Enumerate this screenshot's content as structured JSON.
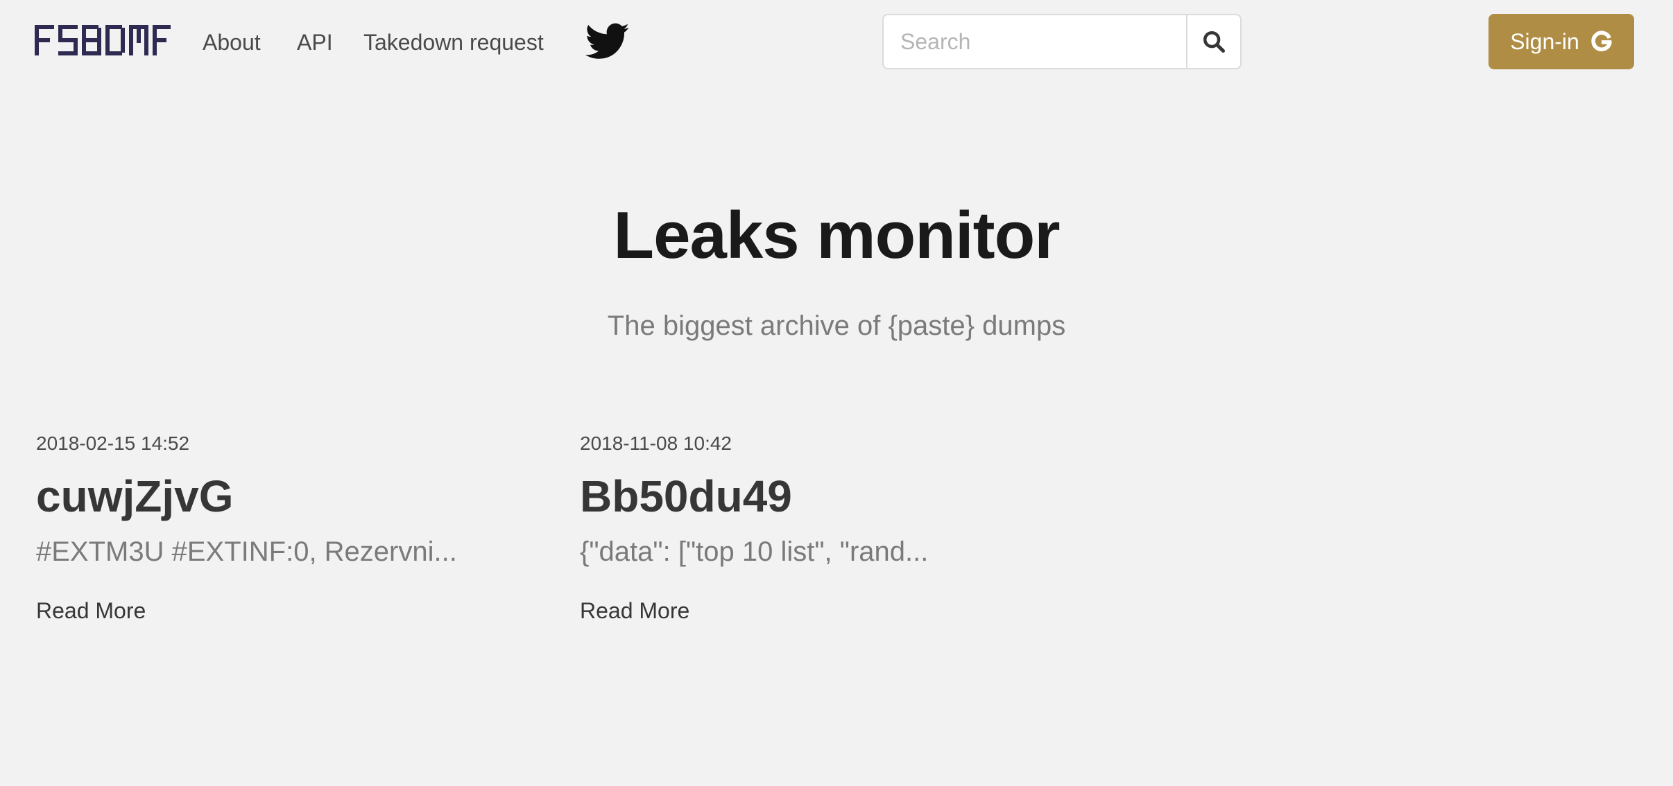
{
  "nav": {
    "logo_text": "FSBDMF",
    "links": [
      {
        "label": "About"
      },
      {
        "label": "API"
      },
      {
        "label": "Takedown request"
      }
    ],
    "twitter_icon": "twitter-bird-icon",
    "search": {
      "placeholder": "Search",
      "value": ""
    },
    "search_icon": "magnifier-icon",
    "signin": {
      "label": "Sign-in",
      "icon": "google-g-icon"
    }
  },
  "colors": {
    "background": "#f2f2f2",
    "logo": "#2e2a52",
    "accent": "#b08d45",
    "title": "#1a1a1a",
    "muted": "#7a7a7a"
  },
  "hero": {
    "title": "Leaks monitor",
    "subtitle": "The biggest archive of {paste} dumps"
  },
  "posts": [
    {
      "date": "2018-02-15 14:52",
      "title": "cuwjZjvG",
      "excerpt": "#EXTM3U #EXTINF:0, Rezervni...",
      "more_label": "Read More"
    },
    {
      "date": "2018-11-08 10:42",
      "title": "Bb50du49",
      "excerpt": "{\"data\": [\"top 10 list\", \"rand...",
      "more_label": "Read More"
    }
  ]
}
